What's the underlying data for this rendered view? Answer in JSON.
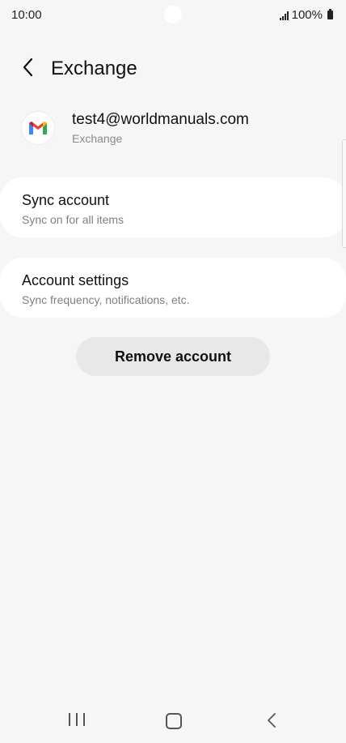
{
  "status_bar": {
    "time": "10:00",
    "battery": "100%",
    "icons": [
      "signal-icon",
      "battery-icon"
    ]
  },
  "header": {
    "title": "Exchange",
    "back_icon": "chevron-left-icon"
  },
  "account": {
    "email": "test4@worldmanuals.com",
    "type": "Exchange",
    "avatar_icon": "gmail-icon"
  },
  "menu": {
    "sync": {
      "title": "Sync account",
      "subtitle": "Sync on for all items"
    },
    "settings": {
      "title": "Account settings",
      "subtitle": "Sync frequency, notifications, etc."
    }
  },
  "remove_label": "Remove account",
  "nav_bar": {
    "icons": [
      "recents-icon",
      "home-icon",
      "back-icon"
    ]
  },
  "colors": {
    "background": "#f6f6f6",
    "card": "#ffffff",
    "button": "#e8e8e8",
    "gmail_red": "#EA4335",
    "gmail_blue": "#4285F4",
    "gmail_green": "#34A853",
    "gmail_yellow": "#FBBC05"
  }
}
